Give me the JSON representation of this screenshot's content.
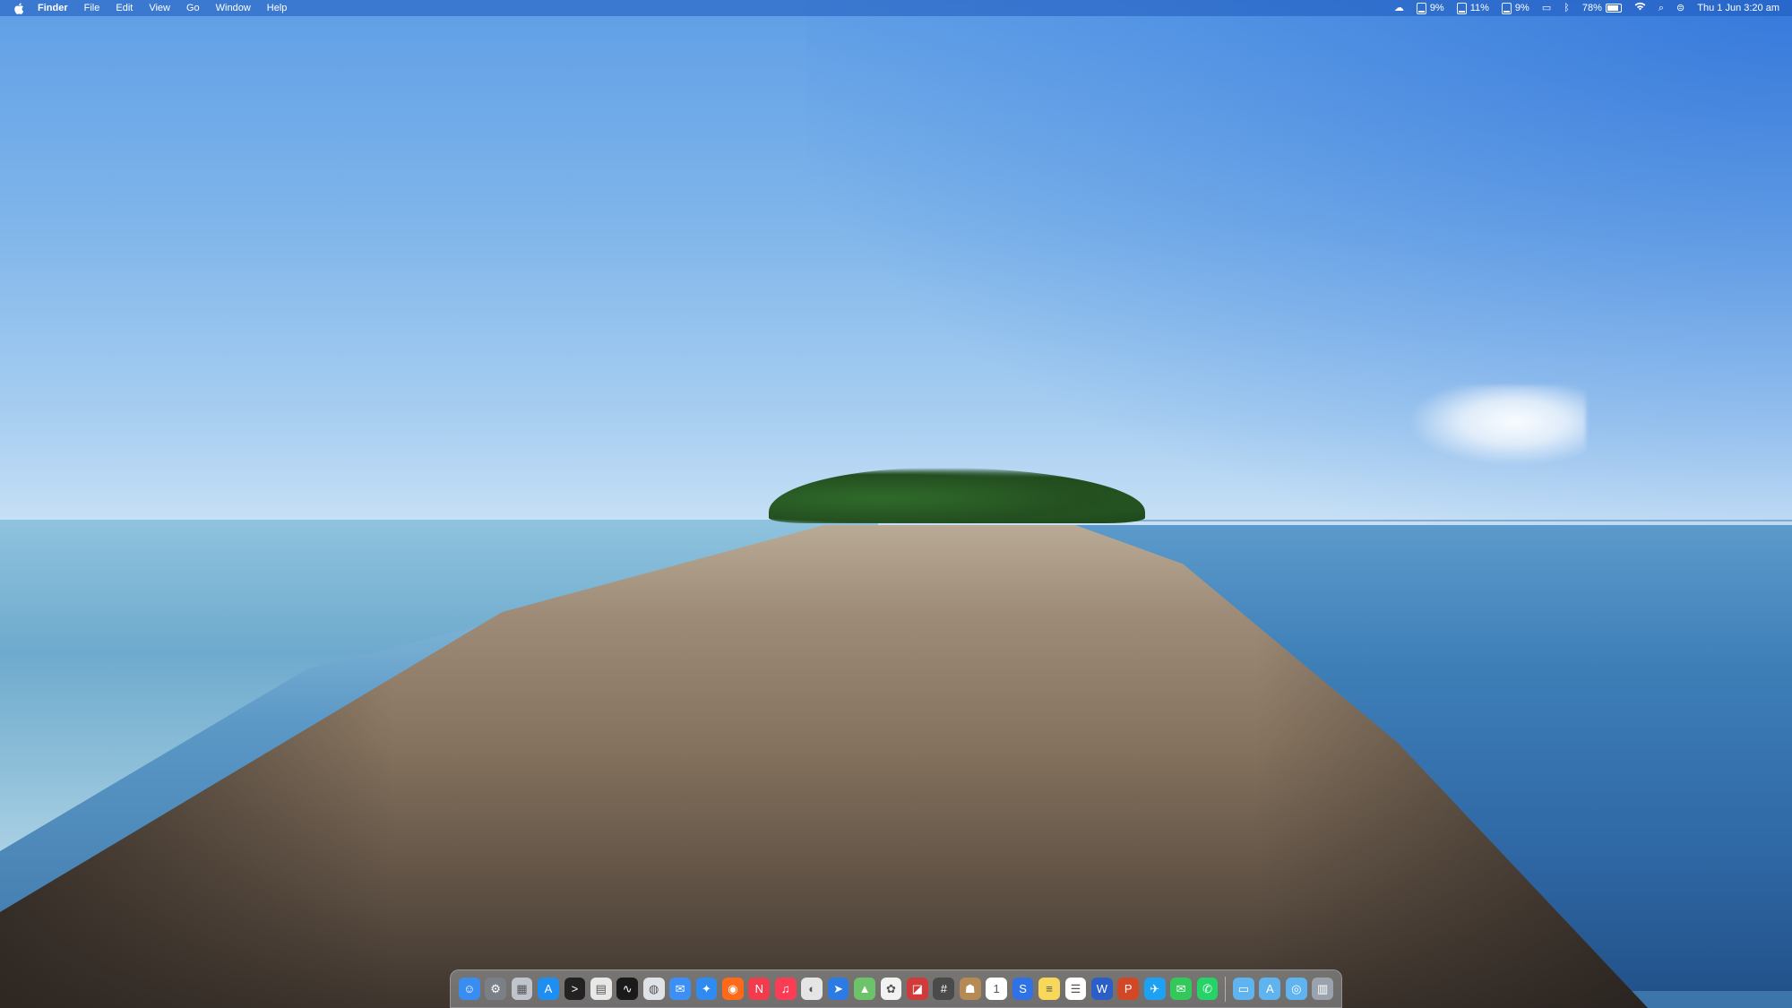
{
  "menubar": {
    "apple_icon": "apple-logo-icon",
    "app_name": "Finder",
    "menus": [
      "File",
      "Edit",
      "View",
      "Go",
      "Window",
      "Help"
    ],
    "status": {
      "cloud_icon": "cloud-icon",
      "cpu_label": "9%",
      "gpu_label": "11%",
      "mem_label": "9%",
      "display_icon": "display-icon",
      "bluetooth_icon": "bluetooth-icon",
      "battery_percent": "78%",
      "battery_level": 0.78,
      "wifi_icon": "wifi-icon",
      "search_icon": "spotlight-search-icon",
      "control_center_icon": "control-center-icon",
      "datetime": "Thu 1 Jun  3:20 am"
    }
  },
  "dock": {
    "apps": [
      {
        "name": "finder-icon",
        "glyph": "☺",
        "color": "#3a8df0"
      },
      {
        "name": "system-preferences-icon",
        "glyph": "⚙",
        "color": "#7b7f86"
      },
      {
        "name": "launchpad-icon",
        "glyph": "▦",
        "color": "#c0c4cc"
      },
      {
        "name": "app-store-icon",
        "glyph": "A",
        "color": "#1f8ef1"
      },
      {
        "name": "terminal-icon",
        "glyph": ">",
        "color": "#222222"
      },
      {
        "name": "preview-icon",
        "glyph": "▤",
        "color": "#e8e8e8"
      },
      {
        "name": "activity-monitor-icon",
        "glyph": "∿",
        "color": "#1a1a1a"
      },
      {
        "name": "disk-utility-icon",
        "glyph": "◍",
        "color": "#dfe3e8"
      },
      {
        "name": "mail-icon",
        "glyph": "✉",
        "color": "#3b8ff5"
      },
      {
        "name": "safari-icon",
        "glyph": "✦",
        "color": "#2f8bf0"
      },
      {
        "name": "firefox-icon",
        "glyph": "◉",
        "color": "#ff6a1a"
      },
      {
        "name": "news-icon",
        "glyph": "N",
        "color": "#f23b4c"
      },
      {
        "name": "music-icon",
        "glyph": "♫",
        "color": "#fa3d55"
      },
      {
        "name": "podcast-capture-icon",
        "glyph": "◐",
        "color": "#e5e5e5"
      },
      {
        "name": "screen-sharing-icon",
        "glyph": "➤",
        "color": "#2c7be5"
      },
      {
        "name": "maps-icon",
        "glyph": "▲",
        "color": "#6cc36a"
      },
      {
        "name": "photos-icon",
        "glyph": "✿",
        "color": "#f2f2f2"
      },
      {
        "name": "photo-booth-icon",
        "glyph": "◪",
        "color": "#d13a3a"
      },
      {
        "name": "calculator-icon",
        "glyph": "#",
        "color": "#4a4a4a"
      },
      {
        "name": "contacts-icon",
        "glyph": "☗",
        "color": "#b58a55"
      },
      {
        "name": "calendar-icon",
        "glyph": "1",
        "color": "#ffffff"
      },
      {
        "name": "shazam-icon",
        "glyph": "S",
        "color": "#2f72e6"
      },
      {
        "name": "notes-icon",
        "glyph": "≡",
        "color": "#f7d85a"
      },
      {
        "name": "reminders-icon",
        "glyph": "☰",
        "color": "#ffffff"
      },
      {
        "name": "word-icon",
        "glyph": "W",
        "color": "#2b5fc7"
      },
      {
        "name": "powerpoint-icon",
        "glyph": "P",
        "color": "#d24726"
      },
      {
        "name": "twitter-icon",
        "glyph": "✈",
        "color": "#1da1f2"
      },
      {
        "name": "messages-icon",
        "glyph": "✉",
        "color": "#34c759"
      },
      {
        "name": "whatsapp-icon",
        "glyph": "✆",
        "color": "#25d366"
      }
    ],
    "folders": [
      {
        "name": "documents-folder-icon",
        "glyph": "▭",
        "color": "#5fb3ee"
      },
      {
        "name": "applications-folder-icon",
        "glyph": "A",
        "color": "#5fb3ee"
      },
      {
        "name": "screenshots-folder-icon",
        "glyph": "◎",
        "color": "#5fb3ee"
      },
      {
        "name": "trash-icon",
        "glyph": "▥",
        "color": "#9aa3ad"
      }
    ]
  }
}
